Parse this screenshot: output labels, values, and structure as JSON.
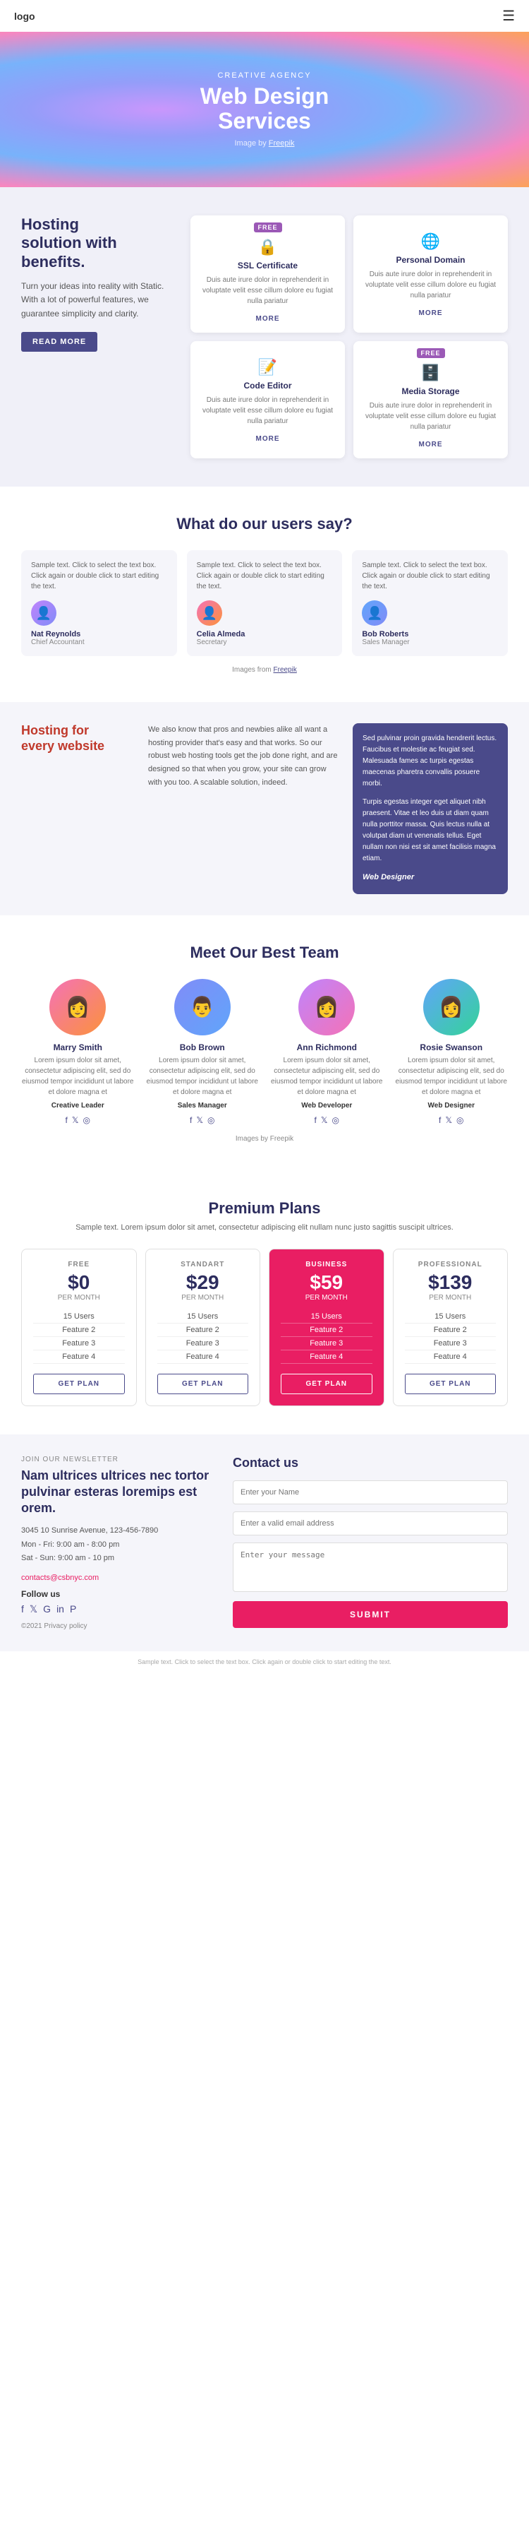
{
  "header": {
    "logo": "logo",
    "menu_icon": "☰"
  },
  "hero": {
    "subtitle": "CREATIVE AGENCY",
    "title": "Web Design\nServices",
    "credit_text": "Image by",
    "credit_link": "Freepik"
  },
  "hosting": {
    "heading": "Hosting\nsolution with\nbenefits.",
    "description": "Turn your ideas into reality with Static. With a lot of powerful features, we guarantee simplicity and clarity.",
    "read_more": "READ MORE",
    "features": [
      {
        "badge": "FREE",
        "icon": "🔒",
        "title": "SSL Certificate",
        "description": "Duis aute irure dolor in reprehenderit in voluptate velit esse cillum dolore eu fugiat nulla pariatur",
        "more": "MORE"
      },
      {
        "badge": null,
        "icon": "🌐",
        "title": "Personal Domain",
        "description": "Duis aute irure dolor in reprehenderit in voluptate velit esse cillum dolore eu fugiat nulla pariatur",
        "more": "MORE"
      },
      {
        "badge": null,
        "icon": "📝",
        "title": "Code Editor",
        "description": "Duis aute irure dolor in reprehenderit in voluptate velit esse cillum dolore eu fugiat nulla pariatur",
        "more": "MORE"
      },
      {
        "badge": "FREE",
        "icon": "🗄️",
        "title": "Media Storage",
        "description": "Duis aute irure dolor in reprehenderit in voluptate velit esse cillum dolore eu fugiat nulla pariatur",
        "more": "MORE"
      }
    ]
  },
  "testimonials": {
    "heading": "What do our users say?",
    "items": [
      {
        "text": "Sample text. Click to select the text box. Click again or double click to start editing the text.",
        "name": "Nat Reynolds",
        "role": "Chief Accountant",
        "avatar_color": "#c084fc"
      },
      {
        "text": "Sample text. Click to select the text box. Click again or double click to start editing the text.",
        "name": "Celia Almeda",
        "role": "Secretary",
        "avatar_color": "#f472b6"
      },
      {
        "text": "Sample text. Click to select the text box. Click again or double click to start editing the text.",
        "name": "Bob Roberts",
        "role": "Sales Manager",
        "avatar_color": "#60a5fa"
      }
    ],
    "images_credit": "Images from",
    "images_link": "Freepik"
  },
  "hosting_every": {
    "heading": "Hosting for\nevery website",
    "heading_color": "#c0392b",
    "middle_text": "We also know that pros and newbies alike all want a hosting provider that's easy and that works. So our robust web hosting tools get the job done right, and are designed so that when you grow, your site can grow with you too. A scalable solution, indeed.",
    "right_text": "Sed pulvinar proin gravida hendrerit lectus. Faucibus et molestie ac feugiat sed. Malesuada fames ac turpis egestas maecenas pharetra convallis posuere morbi.\n\nTurpis egestas integer eget aliquet nibh praesent. Vitae et leo duis ut diam quam nulla porttitor massa. Quis lectus nulla at volutpat diam ut venenatis tellus. Eget nullam non nisi est sit amet facilisis magna etiam.",
    "right_role": "Web Designer"
  },
  "team": {
    "heading": "Meet Our Best Team",
    "members": [
      {
        "name": "Marry Smith",
        "description": "Lorem ipsum dolor sit amet, consectetur adipiscing elit, sed do eiusmod tempor incididunt ut labore et dolore magna et",
        "role": "Creative Leader",
        "avatar_color": "#f472b6"
      },
      {
        "name": "Bob Brown",
        "description": "Lorem ipsum dolor sit amet, consectetur adipiscing elit, sed do eiusmod tempor incididunt ut labore et dolore magna et",
        "role": "Sales Manager",
        "avatar_color": "#818cf8"
      },
      {
        "name": "Ann Richmond",
        "description": "Lorem ipsum dolor sit amet, consectetur adipiscing elit, sed do eiusmod tempor incididunt ut labore et dolore magna et",
        "role": "Web Developer",
        "avatar_color": "#c084fc"
      },
      {
        "name": "Rosie Swanson",
        "description": "Lorem ipsum dolor sit amet, consectetur adipiscing elit, sed do eiusmod tempor incididunt ut labore et dolore magna et",
        "role": "Web Designer",
        "avatar_color": "#60a5fa"
      }
    ],
    "images_credit": "Images by",
    "images_link": "Freepik"
  },
  "plans": {
    "heading": "Premium Plans",
    "subtitle": "Sample text. Lorem ipsum dolor sit amet, consectetur adipiscing elit nullam nunc justo sagittis suscipit ultrices.",
    "items": [
      {
        "name": "FREE",
        "price": "$0",
        "period": "PER MONTH",
        "features": [
          "15 Users",
          "Feature 2",
          "Feature 3",
          "Feature 4"
        ],
        "button": "GET PLAN",
        "highlight": false
      },
      {
        "name": "STANDART",
        "price": "$29",
        "period": "PER MONTH",
        "features": [
          "15 Users",
          "Feature 2",
          "Feature 3",
          "Feature 4"
        ],
        "button": "GET PLAN",
        "highlight": false
      },
      {
        "name": "BUSINESS",
        "price": "$59",
        "period": "PER MONTH",
        "features": [
          "15 Users",
          "Feature 2",
          "Feature 3",
          "Feature 4"
        ],
        "button": "GET PLAN",
        "highlight": true
      },
      {
        "name": "PROFESSIONAL",
        "price": "$139",
        "period": "PER MONTH",
        "features": [
          "15 Users",
          "Feature 2",
          "Feature 3",
          "Feature 4"
        ],
        "button": "GET PLAN",
        "highlight": false
      }
    ]
  },
  "footer": {
    "newsletter_label": "JOIN OUR NEWSLETTER",
    "newsletter_heading": "Nam ultrices ultrices nec tortor pulvinar esteras loremips est orem.",
    "address": "3045 10 Sunrise Avenue, 123-456-7890\nMon - Fri: 9:00 am - 8:00 pm\nSat - Sun: 9:00 am - 10 pm",
    "email": "contacts@csbnyc.com",
    "follow": "Follow us",
    "copyright": "©2021 Privacy policy",
    "contact_heading": "Contact us",
    "name_placeholder": "Enter your Name",
    "email_placeholder": "Enter a valid email address",
    "message_placeholder": "Enter your message",
    "submit": "SUBMIT"
  },
  "bottom_note": "Sample text. Click to select the text box. Click again or double click to start editing the text."
}
